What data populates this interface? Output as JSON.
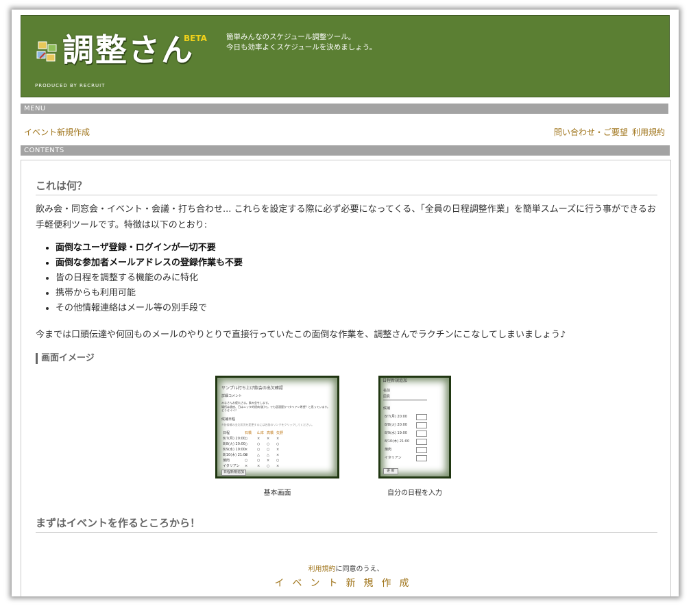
{
  "header": {
    "logo_text": "調整さん",
    "logo_badge": "BETA",
    "produced_by": "PRODUCED BY RECRUIT",
    "tagline_1": "簡単みんなのスケジュール調整ツール。",
    "tagline_2": "今日も効率よくスケジュールを決めましょう。",
    "colors": {
      "header_bg": "#5b7f33",
      "beta": "#f2d21a",
      "link": "#a0751c",
      "bar": "#a3a3a3"
    }
  },
  "menu": {
    "bar_label": "MENU",
    "create_event": "イベント新規作成",
    "contact": "問い合わせ・ご要望",
    "terms": "利用規約"
  },
  "contents": {
    "bar_label": "CONTENTS",
    "what_heading": "これは何？",
    "intro": "飲み会・同窓会・イベント・会議・打ち合わせ... これらを設定する際に必ず必要になってくる、「全員の日程調整作業」を簡単スムーズに行う事ができるお手軽便利ツールです。特徴は以下のとおり:",
    "features": [
      "面倒なユーザ登録・ログインが一切不要",
      "面倒な参加者メールアドレスの登録作業も不要",
      "皆の日程を調整する機能のみに特化",
      "携帯からも利用可能",
      "その他情報連絡はメール等の別手段で"
    ],
    "outro": "今までは口頭伝達や何回ものメールのやりとりで直接行っていたこの面倒な作業を、調整さんでラクチンにこなしてしまいましょう♪",
    "images_heading": "画面イメージ",
    "image_captions": [
      "基本画面",
      "自分の日程を入力"
    ],
    "shot1": {
      "title": "サンプル打ち上げ飲会の出欠確認",
      "comment_label": "詳細コメント",
      "comment_1": "みなさんお疲れさま。飲み会をします。",
      "comment_2": "場所は銀座、日はニッタ的焼肉(仮)で。でも居酒屋かイタリアン希望？と思っています。どうせイイ？",
      "schedule_label": "候補日程",
      "note": "※各候補の出欠状況を変更するには名前のリンクをクリックしてください。",
      "columns": [
        "日程",
        "石橋",
        "山本",
        "高橋",
        "矢野"
      ],
      "rows": [
        [
          "8/7(月) 20:00",
          "○",
          "×",
          "×",
          "×"
        ],
        [
          "8/8(火) 20:00",
          "○",
          "○",
          "○",
          "○"
        ],
        [
          "8/9(水) 19:00",
          "×",
          "○",
          "○",
          "×"
        ],
        [
          "8/10(木) 21:00",
          "×",
          "△",
          "△",
          "×"
        ],
        [
          "焼肉",
          "○",
          "○",
          "×",
          "○"
        ],
        [
          "イタリアン",
          "×",
          "×",
          "○",
          "×"
        ]
      ],
      "button": "日程新規追加"
    },
    "shot2": {
      "title": "日程新規追加",
      "name_label": "名前",
      "name_value": "岡見",
      "schedule_label": "候補",
      "rows": [
        "8/7(月) 20:00",
        "8/8(火) 20:00",
        "8/9(水) 19:00",
        "8/10(木) 21:00",
        "焼肉",
        "イタリアン"
      ],
      "button": "更 新"
    },
    "start_heading": "まずはイベントを作るところから！",
    "agree_link": "利用規約",
    "agree_text": "に同意のうえ、",
    "create_button": "イベント新規作成"
  }
}
